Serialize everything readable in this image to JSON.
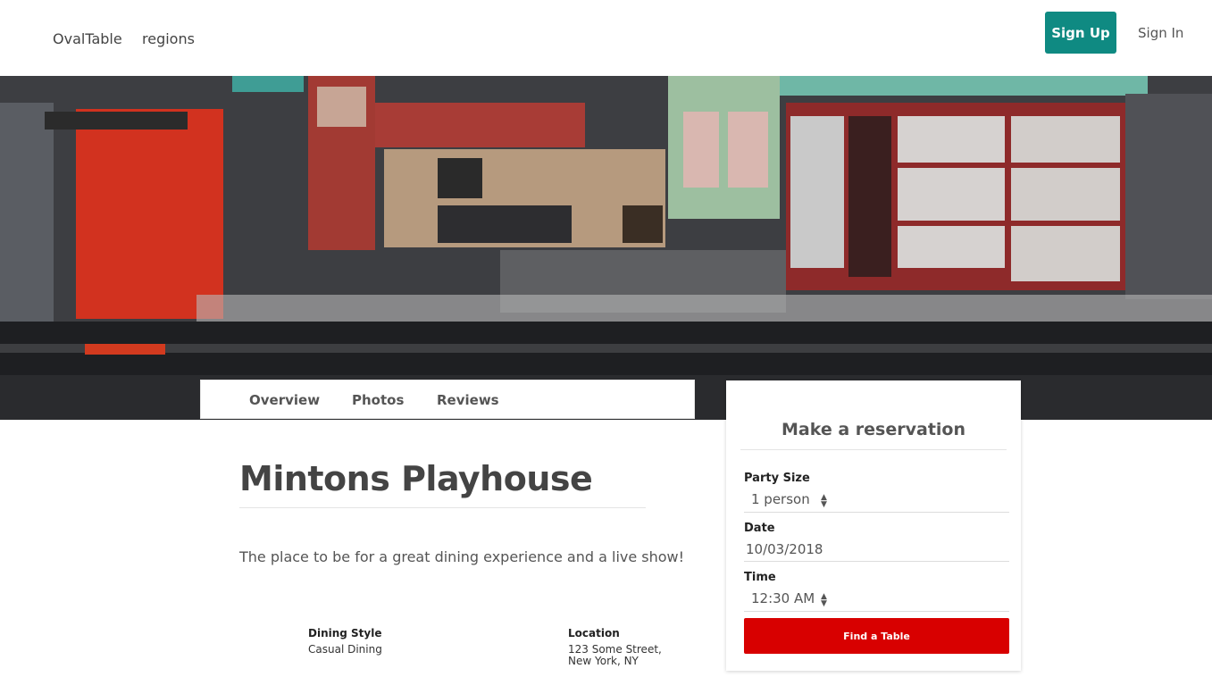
{
  "header": {
    "brand": "OvalTable",
    "regions_link": "regions",
    "signup_label": "Sign Up",
    "signin_label": "Sign In"
  },
  "colors": {
    "accent": "#0f8a82",
    "find_button": "#d80000"
  },
  "tabs": [
    {
      "label": "Overview"
    },
    {
      "label": "Photos"
    },
    {
      "label": "Reviews"
    }
  ],
  "restaurant": {
    "name": "Mintons Playhouse",
    "tagline": "The place to be for a great dining experience and a live show!",
    "details": [
      {
        "label": "Dining Style",
        "value": "Casual Dining"
      },
      {
        "label": "Location",
        "value_line1": "123 Some Street,",
        "value_line2": "New York, NY"
      }
    ]
  },
  "reservation": {
    "title": "Make a reservation",
    "party_label": "Party Size",
    "party_value": "1 person",
    "date_label": "Date",
    "date_value": "10/03/2018",
    "time_label": "Time",
    "time_value": "12:30 AM",
    "find_label": "Find a Table"
  }
}
